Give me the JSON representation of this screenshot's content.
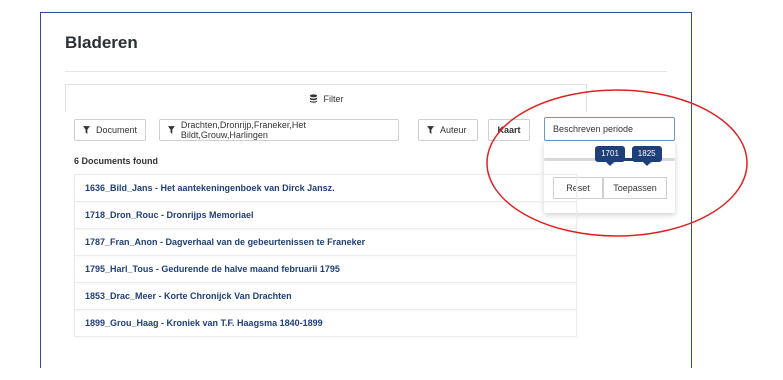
{
  "page": {
    "title": "Bladeren"
  },
  "filter_tab": {
    "label": "Filter",
    "icon": "database-icon"
  },
  "filters": {
    "document": {
      "label": "Document",
      "icon": "funnel-icon"
    },
    "places": {
      "label": "Drachten,Dronrijp,Franeker,Het Bildt,Grouw,Harlingen",
      "icon": "funnel-icon"
    },
    "author": {
      "label": "Auteur",
      "icon": "funnel-icon"
    },
    "map": {
      "label": "Kaart"
    },
    "period": {
      "label": "Beschreven periode"
    }
  },
  "period_popup": {
    "range_min_label": "1701",
    "range_max_label": "1825",
    "range_start_fraction": 0.52,
    "range_end_fraction": 0.8,
    "reset_label": "Reset",
    "apply_label": "Toepassen"
  },
  "results": {
    "count_label": "6 Documents found",
    "items": [
      "1636_Bild_Jans - Het aantekeningenboek van Dirck Jansz.",
      "1718_Dron_Rouc - Dronrijps Memoriael",
      "1787_Fran_Anon - Dagverhaal van de gebeurtenissen te Franeker",
      "1795_Harl_Tous - Gedurende de halve maand februarii 1795",
      "1853_Drac_Meer - Korte Chronijck Van Drachten",
      "1899_Grou_Haag - Kroniek van T.F. Haagsma 1840-1899"
    ]
  },
  "colors": {
    "accent": "#1f3f7a",
    "frame": "#2f4b9c",
    "annotation": "#e02020"
  }
}
